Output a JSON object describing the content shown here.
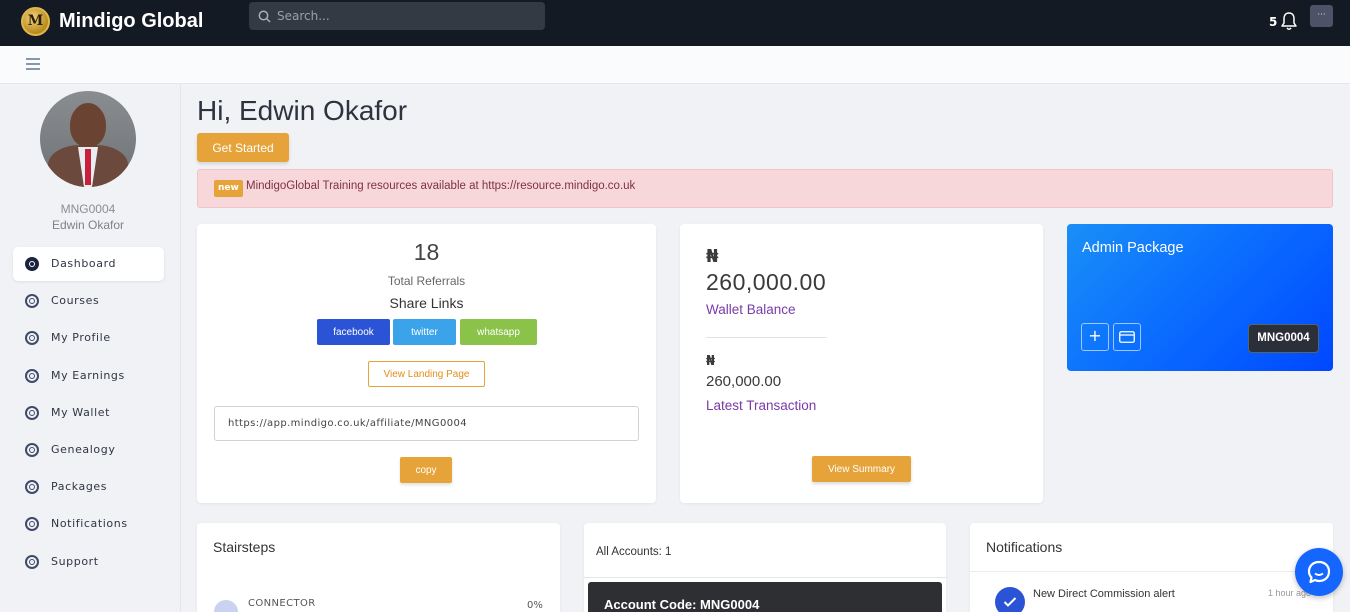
{
  "topbar": {
    "logo_letter": "M",
    "brand": "Mindigo Global",
    "search_placeholder": "Search...",
    "notification_count": "5",
    "user_menu_label": "···"
  },
  "sidebar": {
    "user_id": "MNG0004",
    "user_name": "Edwin Okafor",
    "items": [
      {
        "label": "Dashboard",
        "active": true
      },
      {
        "label": "Courses"
      },
      {
        "label": "My Profile"
      },
      {
        "label": "My Earnings"
      },
      {
        "label": "My Wallet"
      },
      {
        "label": "Genealogy"
      },
      {
        "label": "Packages"
      },
      {
        "label": "Notifications"
      },
      {
        "label": "Support"
      }
    ]
  },
  "main": {
    "greeting": "Hi, Edwin Okafor",
    "get_started": "Get Started",
    "alert": {
      "badge": "new",
      "message": "MindigoGlobal Training resources available at https://resource.mindigo.co.uk"
    },
    "referrals": {
      "count": "18",
      "label": "Total Referrals",
      "share_title": "Share Links",
      "facebook": "facebook",
      "twitter": "twitter",
      "whatsapp": "whatsapp",
      "landing_page": "View Landing Page",
      "affiliate_link": "https://app.mindigo.co.uk/affiliate/MNG0004",
      "copy": "copy"
    },
    "wallet": {
      "currency": "₦",
      "balance": "260,000.00",
      "balance_label": "Wallet Balance",
      "latest": "260,000.00",
      "latest_label": "Latest Transaction",
      "summary": "View Summary"
    },
    "admin_package": {
      "title": "Admin Package",
      "code": "MNG0004"
    },
    "stairsteps": {
      "title": "Stairsteps",
      "level": "CONNECTOR",
      "percent": "0%"
    },
    "accounts": {
      "all": "All Accounts: 1",
      "account_code": "Account Code: MNG0004"
    },
    "notifications": {
      "title": "Notifications",
      "item": "New Direct Commission alert",
      "time": "1 hour ago"
    }
  },
  "colors": {
    "topbar": "#141a24",
    "accent": "#e6a33a",
    "admin_gradient_start": "#1a8ff7",
    "admin_gradient_end": "#0047ff",
    "alert_bg": "#f8d7da",
    "wallet_label": "#7a3aa8"
  }
}
